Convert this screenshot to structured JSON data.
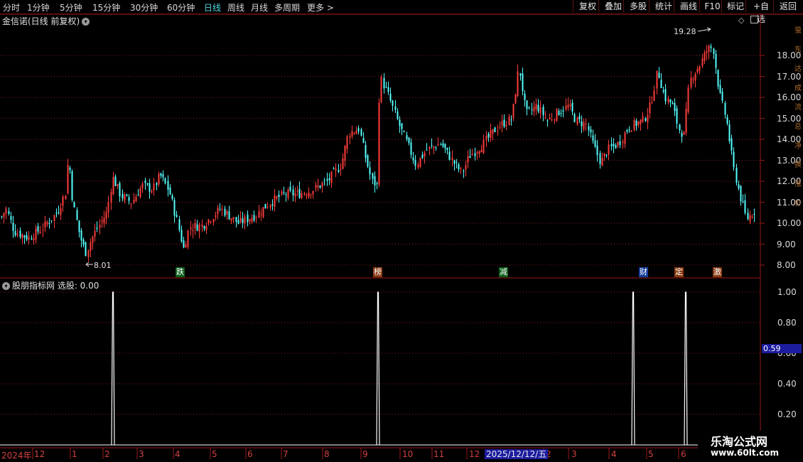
{
  "toolbar": {
    "periods": [
      "分时",
      "1分钟",
      "5分钟",
      "15分钟",
      "30分钟",
      "60分钟",
      "日线",
      "周线",
      "月线",
      "多周期",
      "更多"
    ],
    "more_arrow": ">",
    "active_period": "日线",
    "buttons": [
      "复权",
      "叠加",
      "多股",
      "统计",
      "画线",
      "F10",
      "标记",
      "+自选",
      "返回"
    ]
  },
  "main_chart": {
    "title": "金信诺(日线 前复权)",
    "high_label": "19.28",
    "low_label": "8.01",
    "price_axis": [
      "18.00",
      "17.00",
      "16.00",
      "15.00",
      "14.00",
      "13.00",
      "12.00",
      "11.00",
      "10.00",
      "9.00",
      "8.00"
    ],
    "events": [
      {
        "label": "跌",
        "bg": "#0c5e1a",
        "fg": "#ffffff"
      },
      {
        "label": "榜",
        "bg": "#8a3a10",
        "fg": "#ffffff"
      },
      {
        "label": "减",
        "bg": "#0c5e1a",
        "fg": "#ffffff"
      },
      {
        "label": "财",
        "bg": "#123a9a",
        "fg": "#ffffff"
      },
      {
        "label": "定",
        "bg": "#8a3a10",
        "fg": "#ffffff"
      },
      {
        "label": "激",
        "bg": "#8a3a10",
        "fg": "#ffffff"
      }
    ],
    "colors": {
      "up": "#ff3c3c",
      "down": "#54ffff",
      "grid": "#8c1c1c",
      "border": "#9a1a1a"
    }
  },
  "indicator": {
    "title": "股朋指标网 选股: 0.00",
    "axis": [
      "1.00",
      "0.80",
      "0.60",
      "0.40",
      "0.20"
    ],
    "current_value": "0.59",
    "signals": [
      1.0,
      1.0,
      1.0,
      1.0
    ]
  },
  "x_axis": {
    "labels": [
      "2024年",
      "12",
      "1",
      "2",
      "3",
      "4",
      "5",
      "6",
      "7",
      "8",
      "9",
      "10",
      "11",
      "12",
      "2",
      "3",
      "4",
      "5",
      "6"
    ],
    "cursor_date": "2025/12/12/五"
  },
  "watermark": {
    "title": "乐淘公式网",
    "url": "www.60lt.com"
  },
  "right_strip_chars": [
    "萤",
    "东",
    "达",
    "成",
    "流",
    "总",
    "净",
    "换",
    "涨",
    "价"
  ]
}
